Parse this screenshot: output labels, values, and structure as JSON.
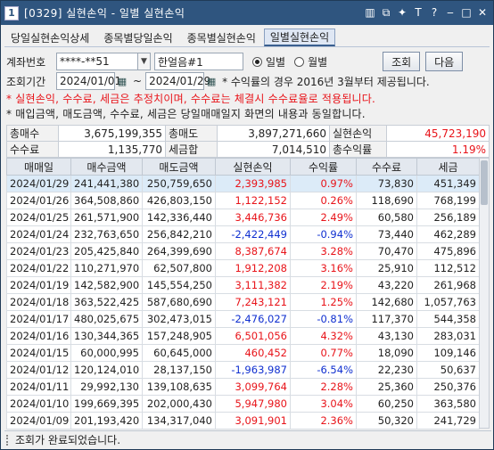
{
  "window": {
    "number": "1",
    "title": "[0329] 실현손익 - 일별 실현손익"
  },
  "titlebar_icons": [
    "window-icon",
    "link-icon",
    "pin-icon",
    "font-icon",
    "help-icon",
    "minimize-icon",
    "maximize-icon",
    "close-icon"
  ],
  "titlebar_glyphs": [
    "▥",
    "⧉",
    "✦",
    "T",
    "?",
    "‒",
    "□",
    "✕"
  ],
  "tabs": [
    {
      "label": "당일실현손익상세"
    },
    {
      "label": "종목별당일손익"
    },
    {
      "label": "종목별실현손익"
    },
    {
      "label": "일별실현손익",
      "active": true
    }
  ],
  "account": {
    "label": "계좌번호",
    "number": "****-**51",
    "name": "한얼음#1"
  },
  "mode": {
    "daily": "일별",
    "monthly": "월별",
    "selected": "daily"
  },
  "buttons": {
    "inquire": "조회",
    "next": "다음"
  },
  "period": {
    "label": "조회기간",
    "from": "2024/01/01",
    "tilde": "~",
    "to": "2024/01/29",
    "note": "* 수익률의 경우 2016년 3월부터 제공됩니다."
  },
  "notes": {
    "warning": "* 실현손익, 수수료, 세금은 추정치이며, 수수료는 체결시 수수료율로 적용됩니다.",
    "info": "* 매입금액, 매도금액, 수수료, 세금은 당일매매일지 화면의 내용과 동일합니다."
  },
  "summary": {
    "buy_total_label": "총매수",
    "buy_total": "3,675,199,355",
    "sell_total_label": "총매도",
    "sell_total": "3,897,271,660",
    "realized_label": "실현손익",
    "realized": "45,723,190",
    "fee_label": "수수료",
    "fee": "1,135,770",
    "tax_label": "세금합",
    "tax": "7,014,510",
    "return_label": "총수익률",
    "return": "1.19%"
  },
  "columns": [
    "매매일",
    "매수금액",
    "매도금액",
    "실현손익",
    "수익률",
    "수수료",
    "세금"
  ],
  "rows": [
    [
      "2024/01/29",
      "241,441,380",
      "250,759,650",
      "2,393,985",
      "0.97%",
      "73,830",
      "451,349"
    ],
    [
      "2024/01/26",
      "364,508,860",
      "426,803,150",
      "1,122,152",
      "0.26%",
      "118,690",
      "768,199"
    ],
    [
      "2024/01/25",
      "261,571,900",
      "142,336,440",
      "3,446,736",
      "2.49%",
      "60,580",
      "256,189"
    ],
    [
      "2024/01/24",
      "232,763,650",
      "256,842,210",
      "-2,422,449",
      "-0.94%",
      "73,440",
      "462,289"
    ],
    [
      "2024/01/23",
      "205,425,840",
      "264,399,690",
      "8,387,674",
      "3.28%",
      "70,470",
      "475,896"
    ],
    [
      "2024/01/22",
      "110,271,970",
      "62,507,800",
      "1,912,208",
      "3.16%",
      "25,910",
      "112,512"
    ],
    [
      "2024/01/19",
      "142,582,900",
      "145,554,250",
      "3,111,382",
      "2.19%",
      "43,220",
      "261,968"
    ],
    [
      "2024/01/18",
      "363,522,425",
      "587,680,690",
      "7,243,121",
      "1.25%",
      "142,680",
      "1,057,763"
    ],
    [
      "2024/01/17",
      "480,025,675",
      "302,473,015",
      "-2,476,027",
      "-0.81%",
      "117,370",
      "544,358"
    ],
    [
      "2024/01/16",
      "130,344,365",
      "157,248,905",
      "6,501,056",
      "4.32%",
      "43,130",
      "283,031"
    ],
    [
      "2024/01/15",
      "60,000,995",
      "60,645,000",
      "460,452",
      "0.77%",
      "18,090",
      "109,146"
    ],
    [
      "2024/01/12",
      "120,124,010",
      "28,137,150",
      "-1,963,987",
      "-6.54%",
      "22,230",
      "50,637"
    ],
    [
      "2024/01/11",
      "29,992,130",
      "139,108,635",
      "3,099,764",
      "2.28%",
      "25,360",
      "250,376"
    ],
    [
      "2024/01/10",
      "199,669,395",
      "202,000,430",
      "5,947,980",
      "3.04%",
      "60,250",
      "363,580"
    ],
    [
      "2024/01/09",
      "201,193,420",
      "134,317,040",
      "3,091,901",
      "2.36%",
      "50,320",
      "241,729"
    ]
  ],
  "status": "조회가 완료되었습니다.",
  "colors": {
    "profit": "#e8141a",
    "loss": "#1030d0",
    "titlebar": "#2f557f",
    "selected_row": "#dcebf8"
  }
}
